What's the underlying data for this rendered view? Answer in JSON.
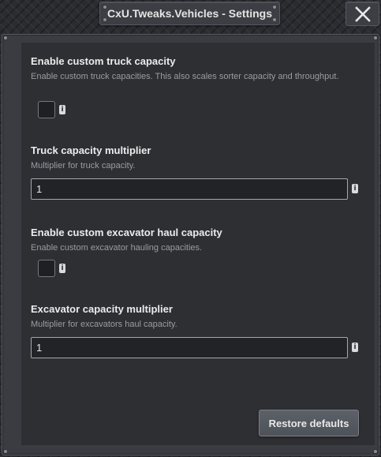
{
  "window": {
    "title": "CxU.Tweaks.Vehicles - Settings",
    "close_icon": "close-icon"
  },
  "settings": [
    {
      "title": "Enable custom truck capacity",
      "description": "Enable custom truck capacities. This also scales sorter capacity and throughput.",
      "type": "checkbox",
      "checked": false,
      "info_glyph": "i"
    },
    {
      "title": "Truck capacity multiplier",
      "description": "Multiplier for truck capacity.",
      "type": "number",
      "value": "1",
      "info_glyph": "i"
    },
    {
      "title": "Enable custom excavator haul capacity",
      "description": "Enable custom excavator hauling capacities.",
      "type": "checkbox",
      "checked": false,
      "info_glyph": "i"
    },
    {
      "title": "Excavator capacity multiplier",
      "description": "Multiplier for excavators haul capacity.",
      "type": "number",
      "value": "1",
      "info_glyph": "i"
    }
  ],
  "footer": {
    "restore_label": "Restore defaults"
  },
  "colors": {
    "background": "#2b2c30",
    "panel": "#3a3c41",
    "content": "#2e2f33",
    "title_text": "#ececec",
    "description_text": "#9a9ca1",
    "input_border": "#a4a7ad",
    "button": "#55595f"
  }
}
